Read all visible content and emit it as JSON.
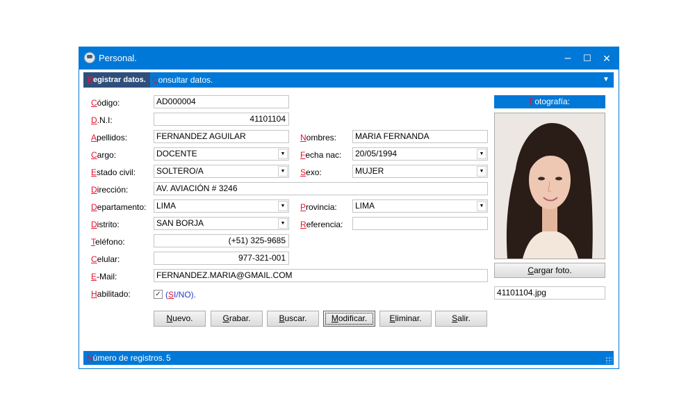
{
  "window": {
    "title": "Personal.",
    "controls": {
      "minimize": "–",
      "maximize": "☐",
      "close": "✕"
    }
  },
  "menu": {
    "tabs": [
      {
        "hotkey": "R",
        "rest": "egistrar datos."
      },
      {
        "hotkey": "C",
        "rest": "onsultar datos."
      }
    ],
    "dropdown_icon": "▼"
  },
  "form": {
    "codigo": {
      "hotkey": "C",
      "rest": "ódigo:",
      "value": "AD000004"
    },
    "dni": {
      "hotkey": "D",
      "rest": ".N.I:",
      "value": "41101104"
    },
    "apellidos": {
      "hotkey": "A",
      "rest": "pellidos:",
      "value": "FERNANDEZ AGUILAR"
    },
    "nombres": {
      "hotkey": "N",
      "rest": "ombres:",
      "value": "MARIA FERNANDA"
    },
    "cargo": {
      "hotkey": "C",
      "rest": "argo:",
      "value": "DOCENTE"
    },
    "fecha_nac": {
      "hotkey": "F",
      "rest": "echa nac:",
      "value": "20/05/1994"
    },
    "estado_civil": {
      "hotkey": "E",
      "rest": "stado civil:",
      "value": "SOLTERO/A"
    },
    "sexo": {
      "hotkey": "S",
      "rest": "exo:",
      "value": "MUJER"
    },
    "direccion": {
      "hotkey": "D",
      "rest": "irección:",
      "value": "AV. AVIACIÓN # 3246"
    },
    "departamento": {
      "hotkey": "D",
      "rest": "epartamento:",
      "value": "LIMA"
    },
    "provincia": {
      "hotkey": "P",
      "rest": "rovincia:",
      "value": "LIMA"
    },
    "distrito": {
      "hotkey": "D",
      "rest": "istrito:",
      "value": "SAN BORJA"
    },
    "referencia": {
      "hotkey": "R",
      "rest": "eferencia:",
      "value": ""
    },
    "telefono": {
      "hotkey": "T",
      "rest": "eléfono:",
      "value": "(+51) 325-9685"
    },
    "celular": {
      "hotkey": "C",
      "rest": "elular:",
      "value": "977-321-001"
    },
    "email": {
      "hotkey": "E",
      "rest": "-Mail:",
      "value": "FERNANDEZ.MARIA@GMAIL.COM"
    },
    "habilitado": {
      "hotkey": "H",
      "rest": "abilitado:",
      "checked": true,
      "check_mark": "✓",
      "option_open": "(",
      "option_hotkey": "S",
      "option_rest": "I/NO)."
    }
  },
  "photo": {
    "header_hotkey": "F",
    "header_rest": "otografía:",
    "load_hotkey": "C",
    "load_rest": "argar foto.",
    "filename": "41101104.jpg"
  },
  "buttons": [
    {
      "hotkey": "N",
      "rest": "uevo."
    },
    {
      "hotkey": "G",
      "rest": "rabar."
    },
    {
      "hotkey": "B",
      "rest": "uscar."
    },
    {
      "hotkey": "M",
      "rest": "odificar."
    },
    {
      "hotkey": "E",
      "rest": "liminar."
    },
    {
      "hotkey": "S",
      "rest": "alir."
    }
  ],
  "status": {
    "hotkey": "N",
    "rest": "úmero de registros.",
    "count": "5"
  },
  "colors": {
    "accent": "#0078d7",
    "hotkey": "#e8112d",
    "active_tab": "#2e4f7a"
  },
  "icons": {
    "combo_arrow": "▼"
  }
}
